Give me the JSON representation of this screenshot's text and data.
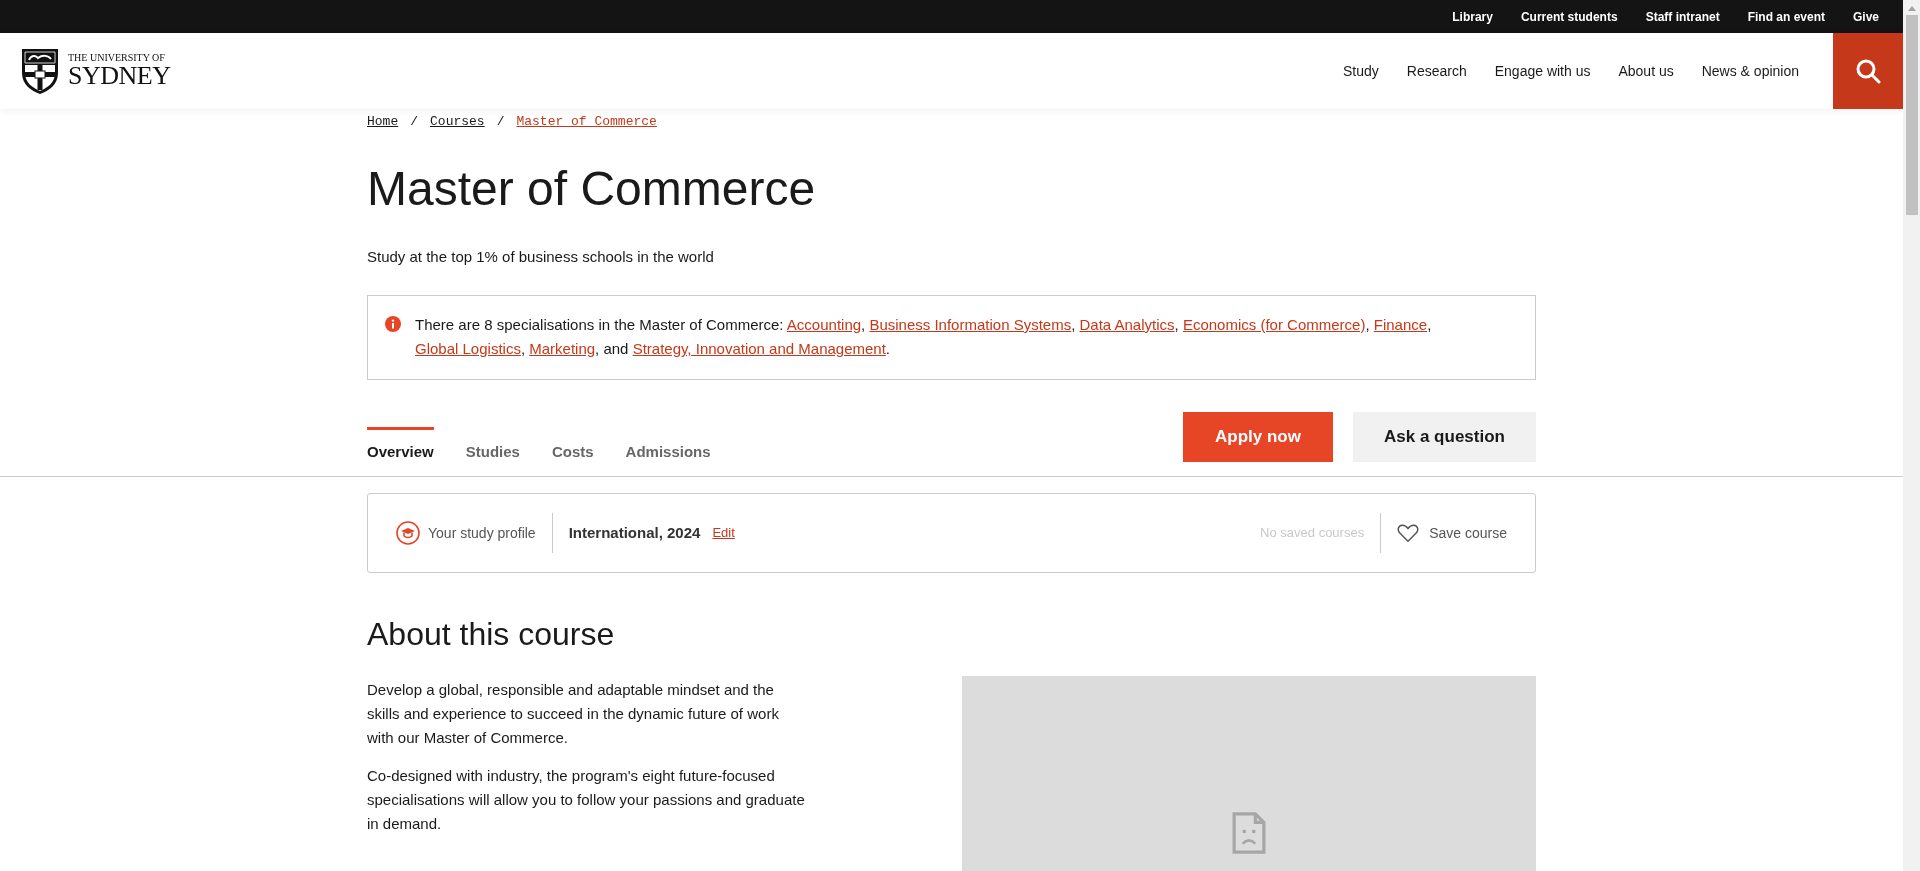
{
  "utility_nav": [
    "Library",
    "Current students",
    "Staff intranet",
    "Find an event",
    "Give"
  ],
  "logo": {
    "line1": "THE UNIVERSITY OF",
    "line2": "SYDNEY"
  },
  "main_nav": [
    "Study",
    "Research",
    "Engage with us",
    "About us",
    "News & opinion"
  ],
  "breadcrumb": [
    {
      "label": "Home",
      "selected": false
    },
    {
      "label": "Courses",
      "selected": false
    },
    {
      "label": "Master of Commerce",
      "selected": true
    }
  ],
  "breadcrumb_separator": "/",
  "title": "Master of Commerce",
  "subtitle": "Study at the top 1% of business schools in the world",
  "notice": [
    {
      "kind": "text",
      "text": "There are 8 specialisations in the Master of Commerce: "
    },
    {
      "kind": "link",
      "text": "Accounting"
    },
    {
      "kind": "text",
      "text": ", "
    },
    {
      "kind": "link",
      "text": "Business Information Systems"
    },
    {
      "kind": "text",
      "text": ", "
    },
    {
      "kind": "link",
      "text": "Data Analytics"
    },
    {
      "kind": "text",
      "text": ", "
    },
    {
      "kind": "link",
      "text": "Economics (for Commerce)"
    },
    {
      "kind": "text",
      "text": ", "
    },
    {
      "kind": "link",
      "text": "Finance"
    },
    {
      "kind": "text",
      "text": ", "
    },
    {
      "kind": "link",
      "text": "Global Logistics"
    },
    {
      "kind": "text",
      "text": ", "
    },
    {
      "kind": "link",
      "text": "Marketing"
    },
    {
      "kind": "text",
      "text": ", and "
    },
    {
      "kind": "link",
      "text": "Strategy, Innovation and Management"
    },
    {
      "kind": "text",
      "text": "."
    }
  ],
  "tabs": [
    {
      "label": "Overview",
      "selected": true
    },
    {
      "label": "Studies",
      "selected": false
    },
    {
      "label": "Costs",
      "selected": false
    },
    {
      "label": "Admissions",
      "selected": false
    }
  ],
  "buttons": [
    {
      "label": "Apply now",
      "kind": "primary"
    },
    {
      "label": "Ask a question",
      "kind": "secondary"
    }
  ],
  "profile": {
    "label": "Your study profile",
    "value": "International, 2024",
    "edit": "Edit",
    "saved": "No saved courses",
    "save": "Save course"
  },
  "about": {
    "heading": "About this course",
    "paragraphs": [
      "Develop a global, responsible and adaptable mindset and the skills and experience to succeed in the dynamic future of work with our Master of Commerce.",
      "Co-designed with industry, the program's eight future-focused specialisations will allow you to follow your passions and graduate in demand."
    ]
  }
}
